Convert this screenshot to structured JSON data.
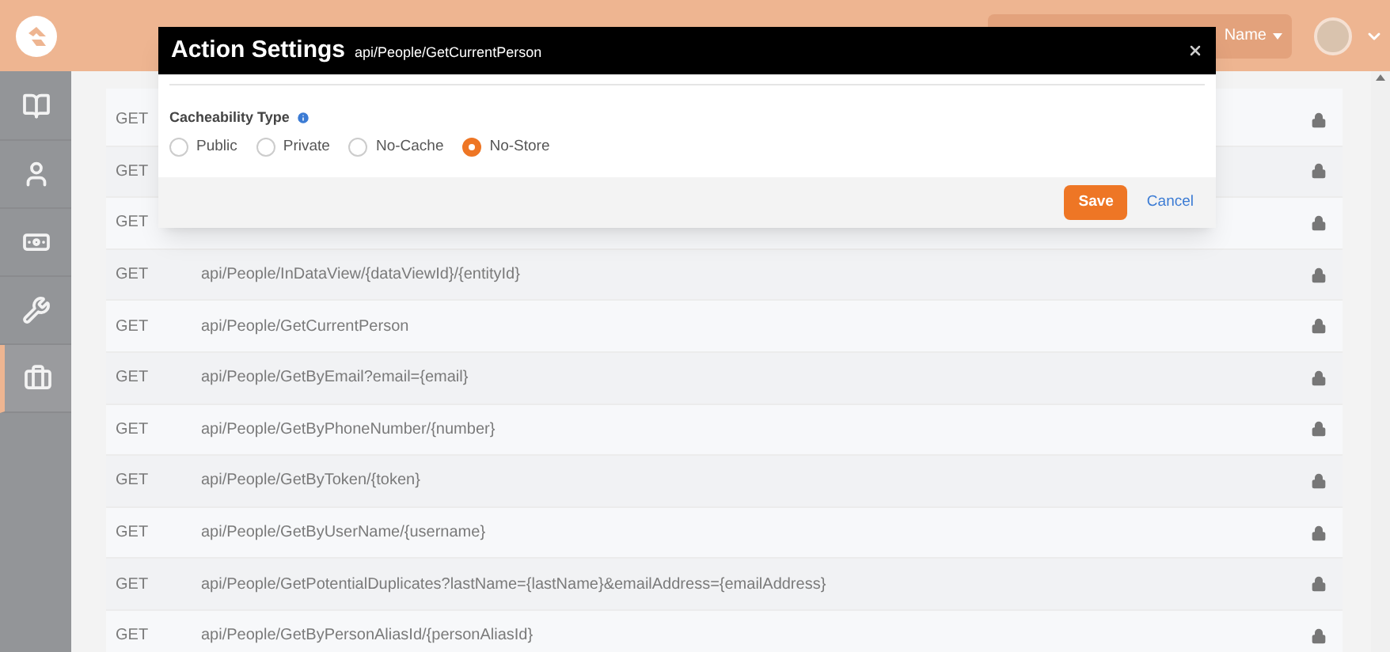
{
  "header": {
    "search": {
      "filter_label": "Name"
    }
  },
  "sidebar": {
    "items": [
      {
        "kind": "book",
        "selected": false
      },
      {
        "kind": "person",
        "selected": false
      },
      {
        "kind": "money",
        "selected": false
      },
      {
        "kind": "wrench",
        "selected": false
      },
      {
        "kind": "briefcase",
        "selected": true
      }
    ]
  },
  "table": {
    "rows": [
      {
        "method": "GET"
      },
      {
        "method": "GET"
      },
      {
        "method": "GET"
      },
      {
        "method": "GET",
        "path": "api/People/InDataView/{dataViewId}/{entityId}"
      },
      {
        "method": "GET",
        "path": "api/People/GetCurrentPerson"
      },
      {
        "method": "GET",
        "path": "api/People/GetByEmail?email={email}"
      },
      {
        "method": "GET",
        "path": "api/People/GetByPhoneNumber/{number}"
      },
      {
        "method": "GET",
        "path": "api/People/GetByToken/{token}"
      },
      {
        "method": "GET",
        "path": "api/People/GetByUserName/{username}"
      },
      {
        "method": "GET",
        "path": "api/People/GetPotentialDuplicates?lastName={lastName}&emailAddress={emailAddress}"
      },
      {
        "method": "GET",
        "path": "api/People/GetByPersonAliasId/{personAliasId}"
      }
    ]
  },
  "modal": {
    "title": "Action Settings",
    "subtitle": "api/People/GetCurrentPerson",
    "field_label": "Cacheability Type",
    "options": [
      {
        "label": "Public",
        "selected": false
      },
      {
        "label": "Private",
        "selected": false
      },
      {
        "label": "No-Cache",
        "selected": false
      },
      {
        "label": "No-Store",
        "selected": true
      }
    ],
    "buttons": [
      {
        "kind": "primary",
        "label": "Save"
      },
      {
        "kind": "link",
        "label": "Cancel"
      }
    ]
  }
}
